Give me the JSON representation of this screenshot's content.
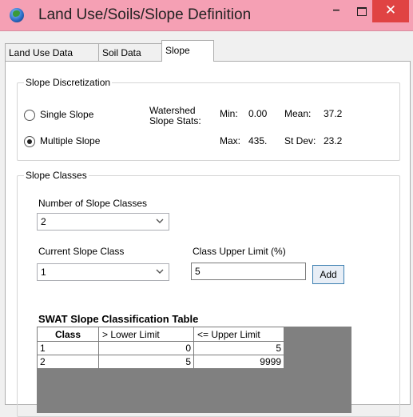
{
  "window": {
    "title": "Land Use/Soils/Slope Definition",
    "minimize_glyph": "–",
    "close_glyph": "✕",
    "icon": "globe-icon"
  },
  "tabs": [
    {
      "label": "Land Use Data",
      "active": false
    },
    {
      "label": "Soil Data",
      "active": false
    },
    {
      "label": "Slope",
      "active": true
    }
  ],
  "discretization": {
    "legend": "Slope Discretization",
    "single_label": "Single Slope",
    "multiple_label": "Multiple Slope",
    "selected": "Multiple Slope",
    "stats_label_line1": "Watershed",
    "stats_label_line2": "Slope Stats:",
    "min_label": "Min:",
    "min_value": "0.00",
    "mean_label": "Mean:",
    "mean_value": "37.2",
    "max_label": "Max:",
    "max_value": "435.",
    "stdev_label": "St Dev:",
    "stdev_value": "23.2"
  },
  "classes": {
    "legend": "Slope Classes",
    "number_label": "Number of Slope Classes",
    "number_value": "2",
    "current_label": "Current Slope Class",
    "current_value": "1",
    "upper_limit_label": "Class Upper Limit (%)",
    "upper_limit_value": "5",
    "add_button": "Add"
  },
  "table": {
    "title": "SWAT Slope Classification Table",
    "headers": [
      "Class",
      "> Lower Limit",
      "<= Upper Limit"
    ],
    "rows": [
      [
        "1",
        "0",
        "5"
      ],
      [
        "2",
        "5",
        "9999"
      ]
    ]
  }
}
